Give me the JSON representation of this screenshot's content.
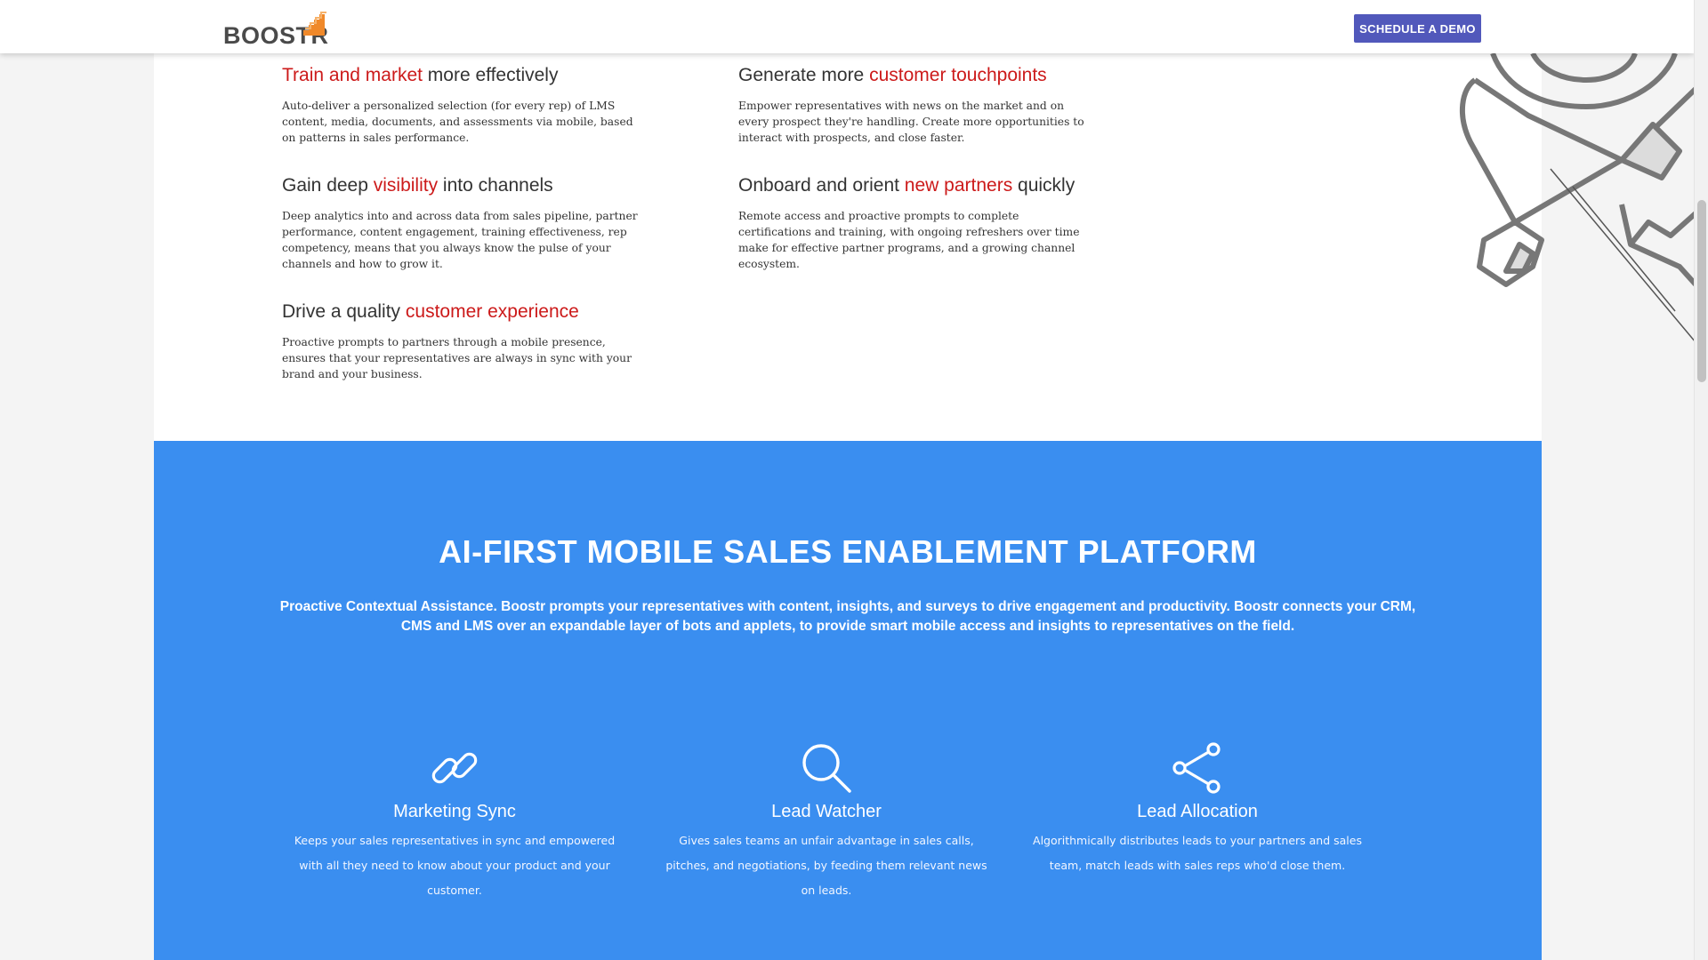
{
  "header": {
    "logo_text": "BOOSTR",
    "cta_label": "SCHEDULE A DEMO",
    "brand_orange": "#f0892a",
    "cta_color": "#5158bb"
  },
  "features": {
    "left": [
      {
        "title_pre": "",
        "title_hl": "Train and market",
        "title_post": " more effectively",
        "body": "Auto-deliver a personalized selection (for every rep) of LMS content, media, documents, and assessments via mobile, based on patterns in sales performance."
      },
      {
        "title_pre": "Gain deep ",
        "title_hl": "visibility",
        "title_post": " into channels",
        "body": "Deep analytics into and across data from sales pipeline, partner performance, content engagement, training effectiveness, rep competency, means that you always know the pulse of your channels and how to grow it."
      },
      {
        "title_pre": "Drive a quality ",
        "title_hl": "customer experience",
        "title_post": "",
        "body": "Proactive prompts to partners through a mobile presence, ensures that your representatives are always in sync with your brand and your business."
      }
    ],
    "right": [
      {
        "title_pre": "Generate more ",
        "title_hl": "customer touchpoints",
        "title_post": "",
        "body": "Empower representatives with news on the market and on every prospect they're handling. Create more opportunities to interact with prospects, and close faster."
      },
      {
        "title_pre": "Onboard and orient ",
        "title_hl": "new partners",
        "title_post": " quickly",
        "body": "Remote access and proactive prompts to complete certifications and training, with ongoing refreshers over time make for effective partner programs, and a growing channel ecosystem."
      }
    ],
    "highlight_color": "#cc1a1a"
  },
  "platform": {
    "title": "AI-FIRST MOBILE SALES ENABLEMENT PLATFORM",
    "description": "Proactive Contextual Assistance. Boostr prompts your representatives with content, insights, and surveys to drive engagement and productivity. Boostr connects your CRM, CMS and LMS over an expandable layer of bots and applets, to provide smart mobile access and insights to representatives on the field.",
    "background": "#3a8ef0",
    "cards": [
      {
        "icon": "link-icon",
        "title": "Marketing Sync",
        "body": "Keeps your sales representatives in sync and empowered with all they need to know about your product and your customer."
      },
      {
        "icon": "magnifier-icon",
        "title": "Lead Watcher",
        "body": "Gives sales teams an unfair advantage in sales calls, pitches, and negotiations, by feeding them relevant news on leads."
      },
      {
        "icon": "share-icon",
        "title": "Lead Allocation",
        "body": "Algorithmically distributes leads to your partners and sales team, match leads with sales reps who'd close them."
      }
    ]
  }
}
